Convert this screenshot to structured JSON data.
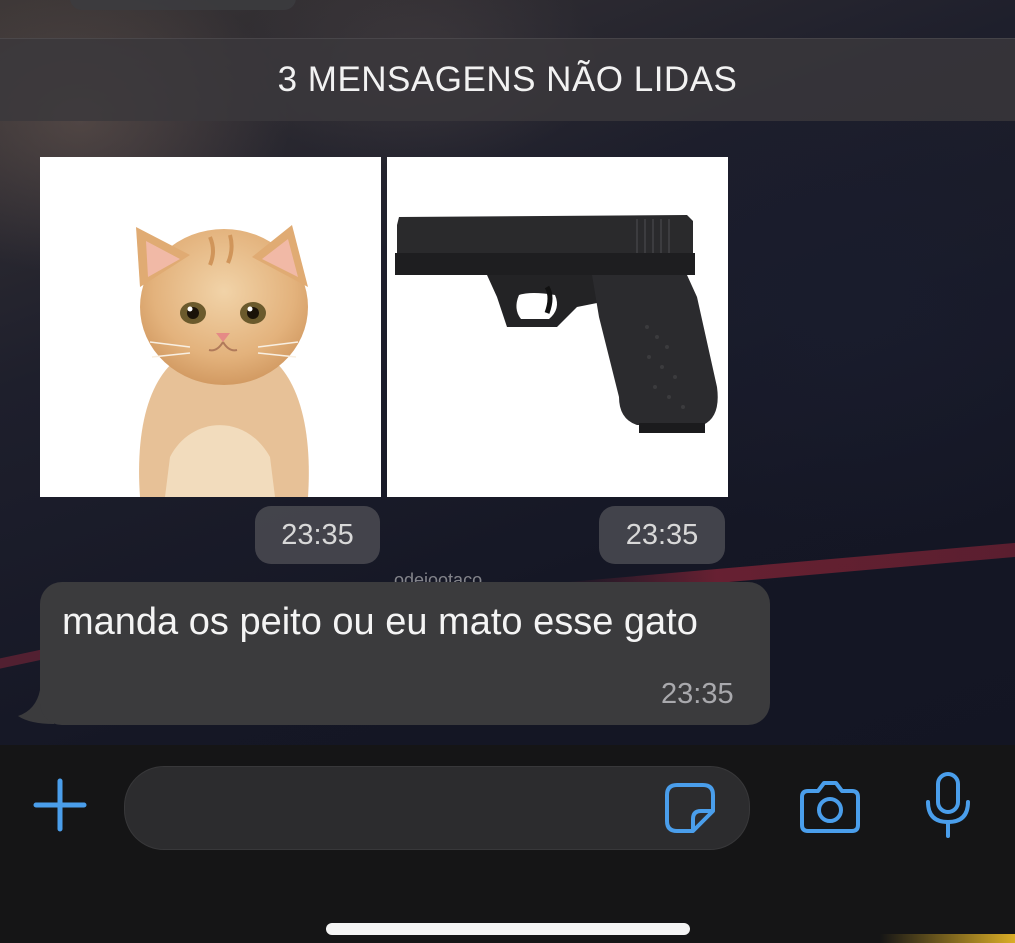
{
  "banner": {
    "text": "3 MENSAGENS NÃO LIDAS"
  },
  "media": [
    {
      "subject": "kitten-photo",
      "time": "23:35"
    },
    {
      "subject": "pistol-photo",
      "time": "23:35"
    }
  ],
  "watermark": "odeiootaco",
  "message": {
    "text": "manda os peito ou eu mato esse gato",
    "time": "23:35"
  },
  "composer": {
    "input_value": "",
    "icons": [
      "plus-icon",
      "sticker-icon",
      "camera-icon",
      "microphone-icon"
    ]
  },
  "colors": {
    "accent": "#4a9eeb",
    "bubble": "#3b3b3d",
    "composer_bg": "#151516"
  }
}
